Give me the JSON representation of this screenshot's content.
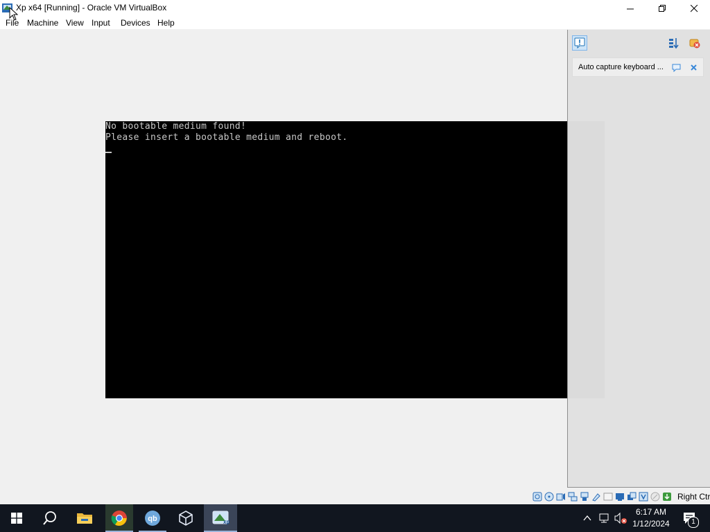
{
  "window": {
    "title": "Xp x64 [Running] - Oracle VM VirtualBox",
    "controls": {
      "minimize": "—",
      "maximize": "❐",
      "close": "✕"
    }
  },
  "menu": {
    "items": [
      "File",
      "Machine",
      "View",
      "Input",
      "Devices",
      "Help"
    ]
  },
  "vm_console": {
    "lines": [
      "No bootable medium found!",
      "Please insert a bootable medium and reboot."
    ]
  },
  "side_panel": {
    "notification_text": "Auto capture keyboard ..."
  },
  "statusbar": {
    "icons": [
      "hard-disk-icon",
      "optical-drive-icon",
      "audio-icon",
      "network-icon",
      "usb-icon",
      "shared-folders-icon",
      "display-icon",
      "video-capture-icon",
      "recording-icon",
      "virtualization-icon",
      "mouse-integration-icon",
      "keyboard-capture-icon"
    ],
    "host_key": "Right Ctrl"
  },
  "taskbar": {
    "time": "6:17 AM",
    "date": "1/12/2024",
    "notification_count": "1"
  },
  "colors": {
    "taskbar": "#11161f",
    "vm_screen": "#000000",
    "console_text": "#c8c8c8",
    "accent": "#0078d7"
  }
}
